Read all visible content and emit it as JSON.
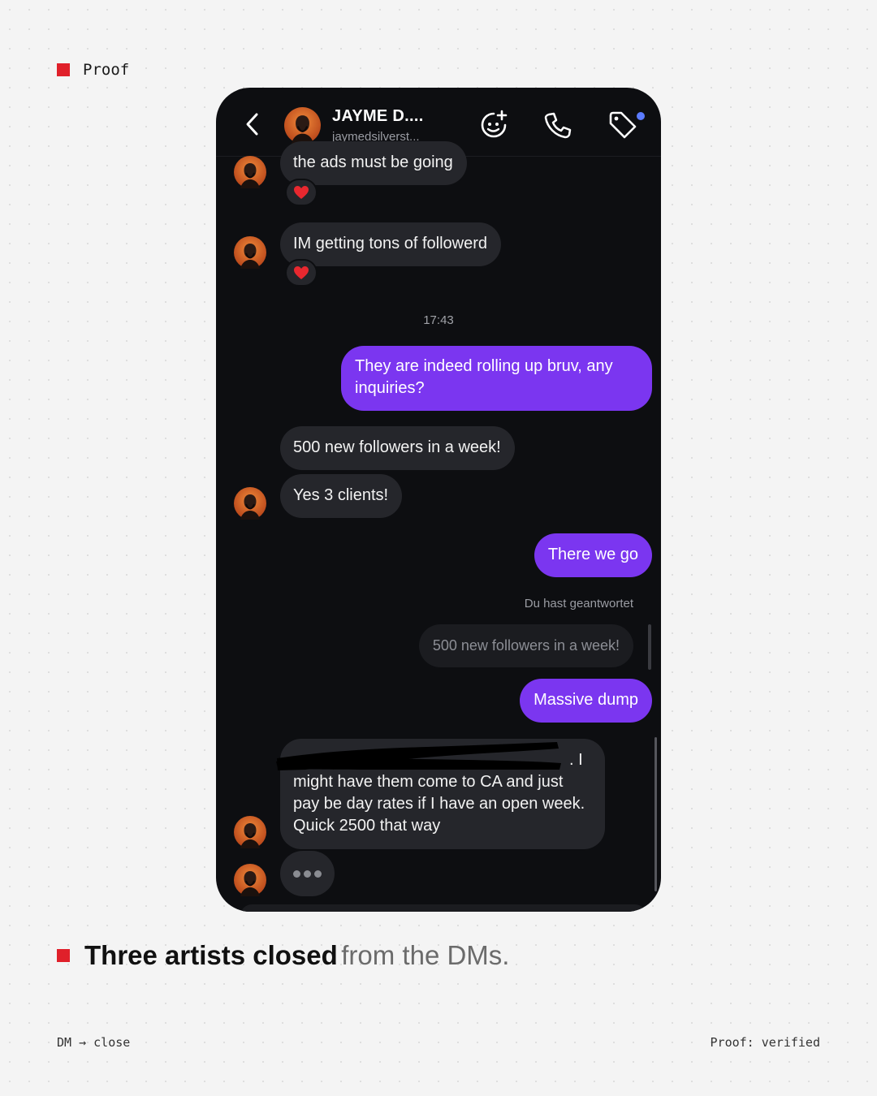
{
  "top_label": "Proof",
  "header": {
    "name": "JAYME D....",
    "username": "jaymedsilverst..."
  },
  "messages": {
    "m1": "the ads must be going",
    "m2": "IM getting tons of followerd",
    "timestamp": "17:43",
    "m3": "They are indeed rolling up bruv, any inquiries?",
    "m4": "500 new followers in a week!",
    "m5": "Yes 3 clients!",
    "m6": "There we go",
    "reply_label": "Du hast geantwortet",
    "reply_quote": "500 new followers in a week!",
    "m7": "Massive dump",
    "m8_visible": ". I might have them come to CA and just pay be day rates if I have an open week. Quick 2500 that way"
  },
  "caption": {
    "strong": "Three artists closed",
    "light": "from the DMs."
  },
  "footer": {
    "left": "DM → close",
    "right": "Proof: verified"
  },
  "colors": {
    "accent_red": "#e0202a",
    "outgoing_bubble": "#7b36f0",
    "incoming_bubble": "#25262b",
    "chat_bg": "#0d0e11",
    "notification_dot": "#5b7bff"
  },
  "icons": [
    "back-chevron-icon",
    "sticker-add-icon",
    "phone-icon",
    "tag-icon",
    "heart-icon",
    "typing-dots-icon"
  ]
}
